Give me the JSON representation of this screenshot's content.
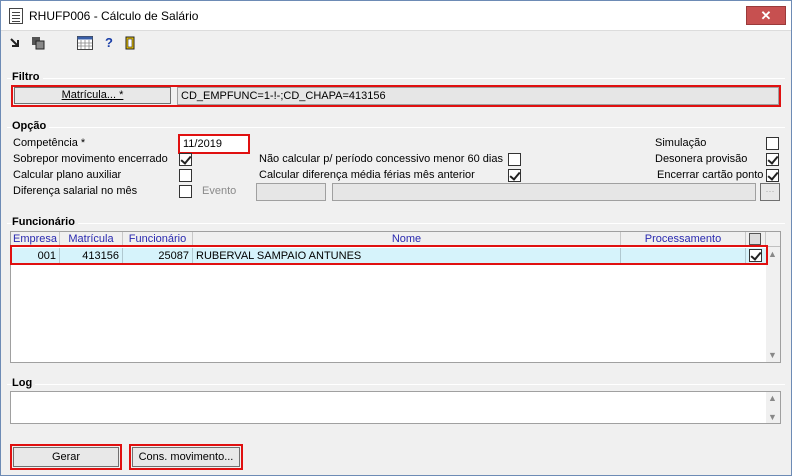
{
  "window": {
    "title": "RHUFP006 - Cálculo de Salário",
    "close_glyph": "✕"
  },
  "toolbar": {
    "icons": [
      "export-icon",
      "copy-icon",
      "calendar-grid-icon",
      "help-icon",
      "exit-door-icon"
    ]
  },
  "filtro": {
    "label": "Filtro",
    "button_label": "Matrícula... *",
    "value": "CD_EMPFUNC=1-!-;CD_CHAPA=413156"
  },
  "opcao": {
    "label": "Opção",
    "competencia_label": "Competência *",
    "competencia_value": "11/2019",
    "sobrepor_label": "Sobrepor movimento encerrado",
    "sobrepor_checked": true,
    "calcular_plano_label": "Calcular plano auxiliar",
    "calcular_plano_checked": false,
    "diferenca_label": "Diferença salarial no mês",
    "diferenca_checked": false,
    "evento_label": "Evento",
    "evento_value": "",
    "evento_desc": "",
    "nao_calcular_label": "Não calcular p/ período concessivo menor 60 dias",
    "nao_calcular_checked": false,
    "calcular_dif_label": "Calcular diferença média férias mês anterior",
    "calcular_dif_checked": true,
    "simulacao_label": "Simulação",
    "simulacao_checked": false,
    "desonera_label": "Desonera provisão",
    "desonera_checked": true,
    "encerrar_label": "Encerrar cartão ponto",
    "encerrar_checked": true
  },
  "funcionario": {
    "label": "Funcionário",
    "columns": [
      "Empresa",
      "Matrícula",
      "Funcionário",
      "Nome",
      "Processamento"
    ],
    "rows": [
      {
        "empresa": "001",
        "matricula": "413156",
        "funcionario": "25087",
        "nome": "RUBERVAL SAMPAIO ANTUNES",
        "processamento": "",
        "selected": true
      }
    ]
  },
  "log": {
    "label": "Log",
    "content": ""
  },
  "footer": {
    "gerar_label": "Gerar",
    "cons_label": "Cons. movimento..."
  }
}
